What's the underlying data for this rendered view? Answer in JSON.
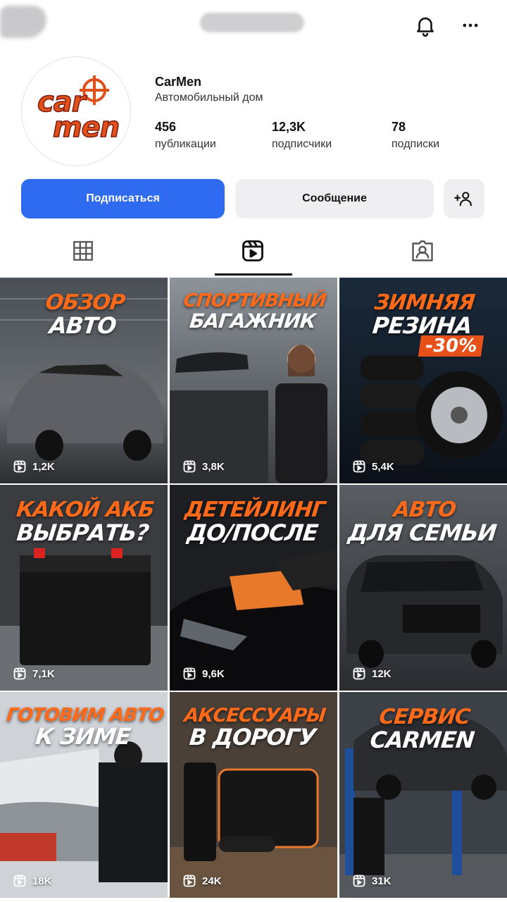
{
  "profile": {
    "name": "CarMen",
    "category": "Автомобильный дом",
    "stats": [
      {
        "value": "456",
        "label": "публикации"
      },
      {
        "value": "12,3K",
        "label": "подписчики"
      },
      {
        "value": "78",
        "label": "подписки"
      }
    ]
  },
  "avatar": {
    "logo_line1": "car",
    "logo_line2": "men"
  },
  "actions": {
    "follow_label": "Подписаться",
    "message_label": "Сообщение",
    "follow_color": "#2f6bf0"
  },
  "icons": {
    "bell": "bell-icon",
    "more": "more-icon",
    "add_person": "add-person-icon",
    "grid_tab": "grid-icon",
    "reels_tab": "reels-icon",
    "tagged_tab": "tagged-icon",
    "reel_badge": "reel-icon"
  },
  "tabs": {
    "active": "reels"
  },
  "reels": [
    {
      "line1": "ОБЗОР",
      "line2": "АВТО",
      "views": "1,2K"
    },
    {
      "line1": "СПОРТИВНЫЙ",
      "line2": "БАГАЖНИК",
      "views": "3,8K"
    },
    {
      "line1": "ЗИМНЯЯ",
      "line2": "РЕЗИНА",
      "badge": "-30%",
      "views": "5,4K"
    },
    {
      "line1": "КАКОЙ АКБ",
      "line2": "ВЫБРАТЬ?",
      "views": "7,1K"
    },
    {
      "line1": "ДЕТЕЙЛИНГ",
      "line2": "ДО/ПОСЛЕ",
      "views": "9,6K"
    },
    {
      "line1": "АВТО",
      "line2": "ДЛЯ СЕМЬИ",
      "views": "12K"
    },
    {
      "line1": "ГОТОВИМ АВТО",
      "line2": "К ЗИМЕ",
      "views": "18K"
    },
    {
      "line1": "АКСЕССУАРЫ",
      "line2": "В ДОРОГУ",
      "views": "24K"
    },
    {
      "line1": "СЕРВИС",
      "line2": "CARMEN",
      "views": "31K"
    }
  ],
  "colors": {
    "accent_orange": "#ff6a1a",
    "brand_blue": "#2f6bf0"
  }
}
